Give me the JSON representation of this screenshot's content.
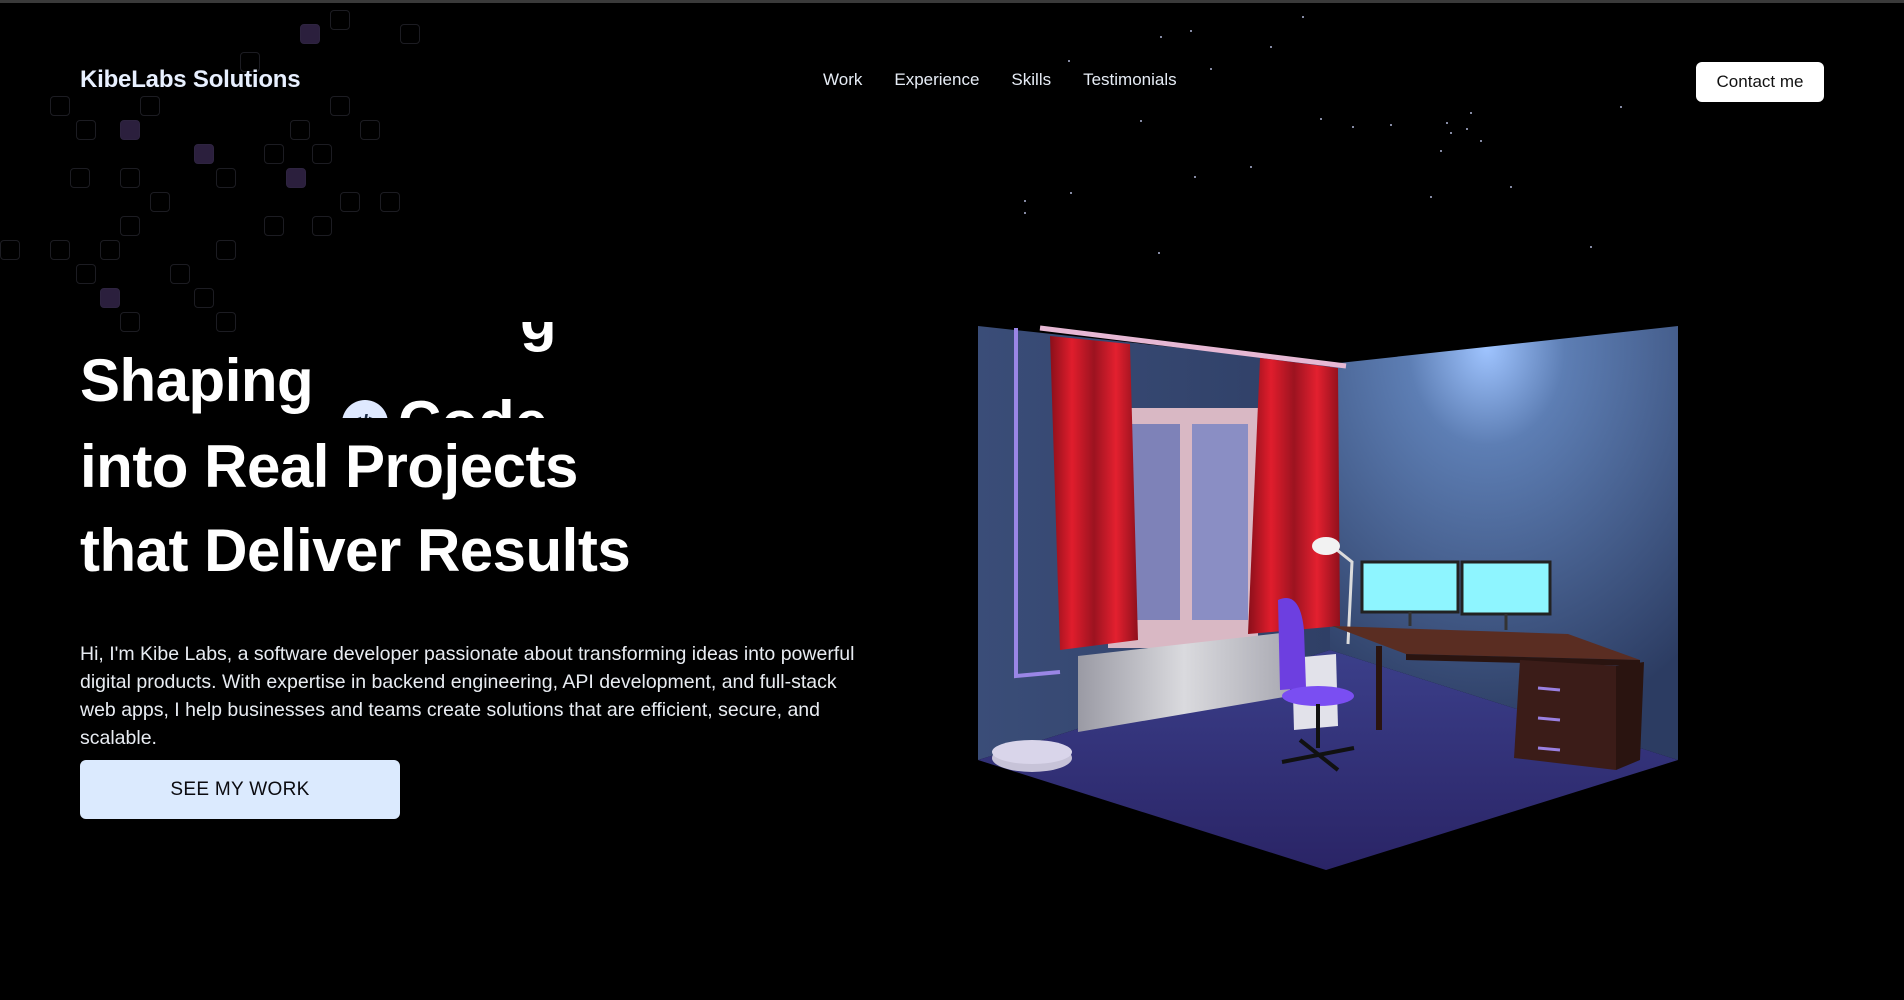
{
  "brand": {
    "name": "KibeLabs Solutions"
  },
  "nav": {
    "items": [
      "Work",
      "Experience",
      "Skills",
      "Testimonials"
    ]
  },
  "header": {
    "contact_label": "Contact me"
  },
  "hero": {
    "line1_word": "Shaping",
    "rotating_word": "Code",
    "rotating_icon": "code-icon",
    "line2": "into Real Projects",
    "line3": "that Deliver Results",
    "intro": "Hi, I'm Kibe Labs, a software developer passionate about transforming ideas into powerful digital products. With expertise in backend engineering, API development, and full-stack web apps, I help businesses and teams create solutions that are efficient, secure, and scalable.",
    "cta_label": "SEE MY WORK"
  },
  "colors": {
    "background": "#000000",
    "cta_bg": "#dbeafe",
    "accent_purple": "#7c3aed",
    "curtain_red": "#d11a2a",
    "monitor_cyan": "#8ef5ff"
  }
}
